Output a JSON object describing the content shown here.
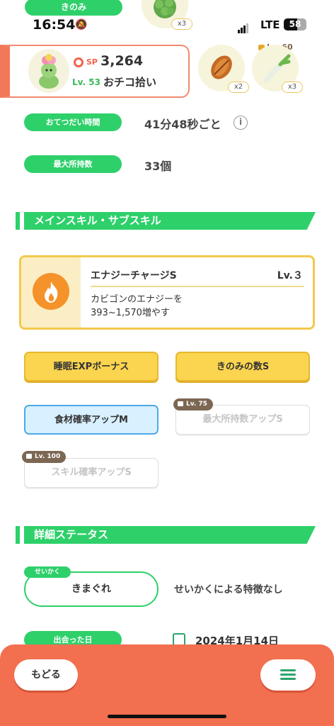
{
  "status_bar": {
    "time": "16:54",
    "network": "LTE",
    "battery": "58"
  },
  "top_header": {
    "pill_label": "きのみ",
    "berry_count": "x3"
  },
  "pokemon": {
    "sp_label": "SP",
    "sp_value": "3,264",
    "level": "Lv. 53",
    "name": "おチコ拾い"
  },
  "ingredients": [
    {
      "icon": "cacao-icon",
      "count": "x2"
    },
    {
      "icon": "leek-icon",
      "count": "x3",
      "lock_level": "Lv. 60"
    }
  ],
  "help_time": {
    "label": "おてつだい時間",
    "value": "41分48秒ごと"
  },
  "max_carry": {
    "label": "最大所持数",
    "value": "33個"
  },
  "skills_section": {
    "title": "メインスキル・サブスキル"
  },
  "main_skill": {
    "name": "エナジーチャージS",
    "level": "Lv.３",
    "desc_line1": "カビゴンのエナジーを",
    "desc_line2": "393~1,570増やす"
  },
  "sub_skills": [
    {
      "label": "睡眠EXPボーナス",
      "style": "gold"
    },
    {
      "label": "きのみの数S",
      "style": "gold"
    },
    {
      "label": "食材確率アップM",
      "style": "blue"
    },
    {
      "label": "最大所持数アップS",
      "style": "locked",
      "lock": "Lv. 75"
    },
    {
      "label": "スキル確率アップS",
      "style": "locked",
      "lock": "Lv. 100"
    }
  ],
  "details_section": {
    "title": "詳細ステータス"
  },
  "nature": {
    "tag": "せいかく",
    "value": "きまぐれ",
    "effect": "せいかくによる特徴なし"
  },
  "met_date": {
    "label": "出会った日",
    "value": "2024年1月14日"
  },
  "bottom_nav": {
    "back_label": "もどる"
  }
}
